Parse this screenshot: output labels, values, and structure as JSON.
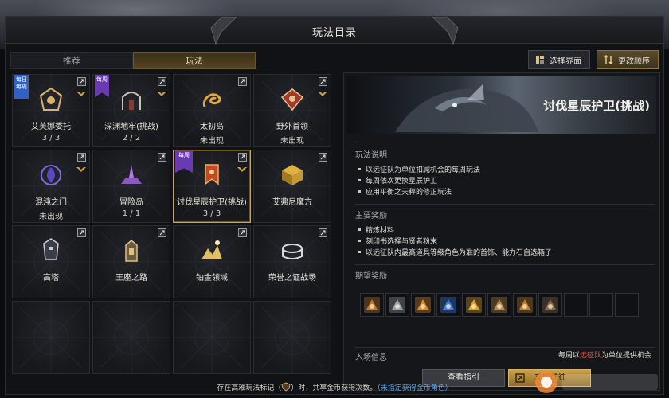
{
  "window": {
    "title": "玩法目录"
  },
  "tabs": [
    {
      "label": "推荐",
      "active": false
    },
    {
      "label": "玩法",
      "active": true
    }
  ],
  "top_buttons": {
    "select_screen": "选择界面",
    "change_order": "更改顺序"
  },
  "grid": [
    {
      "name": "艾芙娜委托",
      "count": "3 / 3",
      "ribbon": "每日每周",
      "ribbon_color": "#2f62c4",
      "emblem": "guild-emblem-icon",
      "has_rank": true
    },
    {
      "name": "深渊地牢(挑战)",
      "count": "2 / 2",
      "ribbon": "每周",
      "ribbon_color": "#6a3ab2",
      "emblem": "dungeon-gate-icon",
      "has_rank": true
    },
    {
      "name": "太初岛",
      "count": "未出现",
      "ribbon": "",
      "emblem": "serpent-icon",
      "has_rank": false
    },
    {
      "name": "野外首领",
      "count": "未出现",
      "ribbon": "",
      "emblem": "boss-skull-icon",
      "has_rank": true
    },
    {
      "name": "混沌之门",
      "count": "未出现",
      "ribbon": "",
      "emblem": "chaos-vortex-icon",
      "has_rank": true
    },
    {
      "name": "冒险岛",
      "count": "1 / 1",
      "ribbon": "",
      "emblem": "island-icon",
      "has_rank": false
    },
    {
      "name": "讨伐星辰护卫(挑战)",
      "count": "3 / 3",
      "ribbon": "每周",
      "ribbon_color": "#6a3ab2",
      "emblem": "guardian-banner-icon",
      "has_rank": true,
      "selected": true
    },
    {
      "name": "艾弗尼魔方",
      "count": "",
      "ribbon": "",
      "emblem": "cube-icon",
      "has_rank": false
    },
    {
      "name": "高塔",
      "count": "",
      "ribbon": "",
      "emblem": "tower-helm-icon",
      "has_rank": false
    },
    {
      "name": "王座之路",
      "count": "",
      "ribbon": "",
      "emblem": "throne-icon",
      "has_rank": false
    },
    {
      "name": "铂金领域",
      "count": "",
      "ribbon": "",
      "emblem": "platinum-field-icon",
      "has_rank": false
    },
    {
      "name": "荣誉之证战场",
      "count": "",
      "ribbon": "",
      "emblem": "colosseum-icon",
      "has_rank": false
    },
    {
      "name": "",
      "count": "",
      "ribbon": "",
      "emblem": ""
    },
    {
      "name": "",
      "count": "",
      "ribbon": "",
      "emblem": ""
    },
    {
      "name": "",
      "count": "",
      "ribbon": "",
      "emblem": ""
    },
    {
      "name": "",
      "count": "",
      "ribbon": "",
      "emblem": ""
    }
  ],
  "detail": {
    "title": "讨伐星辰护卫(挑战)",
    "play_desc_head": "玩法说明",
    "play_desc": [
      "以远征队为单位扣减机会的每周玩法",
      "每周依次更换星辰护卫",
      "应用平衡之天秤的修正玩法"
    ],
    "main_reward_head": "主要奖励",
    "main_rewards": [
      "精炼材料",
      "刻印书选择与贤者粉末",
      "以远征队内最高道具等级角色为准的首饰、能力石自选箱子"
    ],
    "expected_reward_head": "期望奖励",
    "reward_items": [
      {
        "icon": "chest-icon",
        "color": "#c07a30"
      },
      {
        "icon": "gear-chest-icon",
        "color": "#9a9ea6"
      },
      {
        "icon": "fire-orb-icon",
        "color": "#e08a30"
      },
      {
        "icon": "blue-gem-icon",
        "color": "#3f7fe0"
      },
      {
        "icon": "crystal-icon",
        "color": "#e0a030"
      },
      {
        "icon": "treasure-chest-icon",
        "color": "#b88a4a"
      },
      {
        "icon": "book-icon",
        "color": "#c08030"
      },
      {
        "icon": "coffer-icon",
        "color": "#8a6a4a"
      },
      {
        "icon": "",
        "color": ""
      },
      {
        "icon": "",
        "color": ""
      },
      {
        "icon": "",
        "color": ""
      }
    ],
    "entry_head": "入场信息",
    "entry_prefix": "每周以",
    "entry_highlight": "远征队",
    "entry_suffix": "为单位提供机会",
    "guide_button": "查看指引",
    "go_button": "立即前往"
  },
  "footer": {
    "prefix": "存在高难玩法标记（",
    "middle": "）时，共享金币获得次数。",
    "blue": "（未指定获得金币角色）"
  },
  "colors": {
    "accent_gold": "#c9a04c",
    "selected_border": "#c9a35a",
    "highlight_red": "#e05a48",
    "link_blue": "#5aa2e8"
  }
}
